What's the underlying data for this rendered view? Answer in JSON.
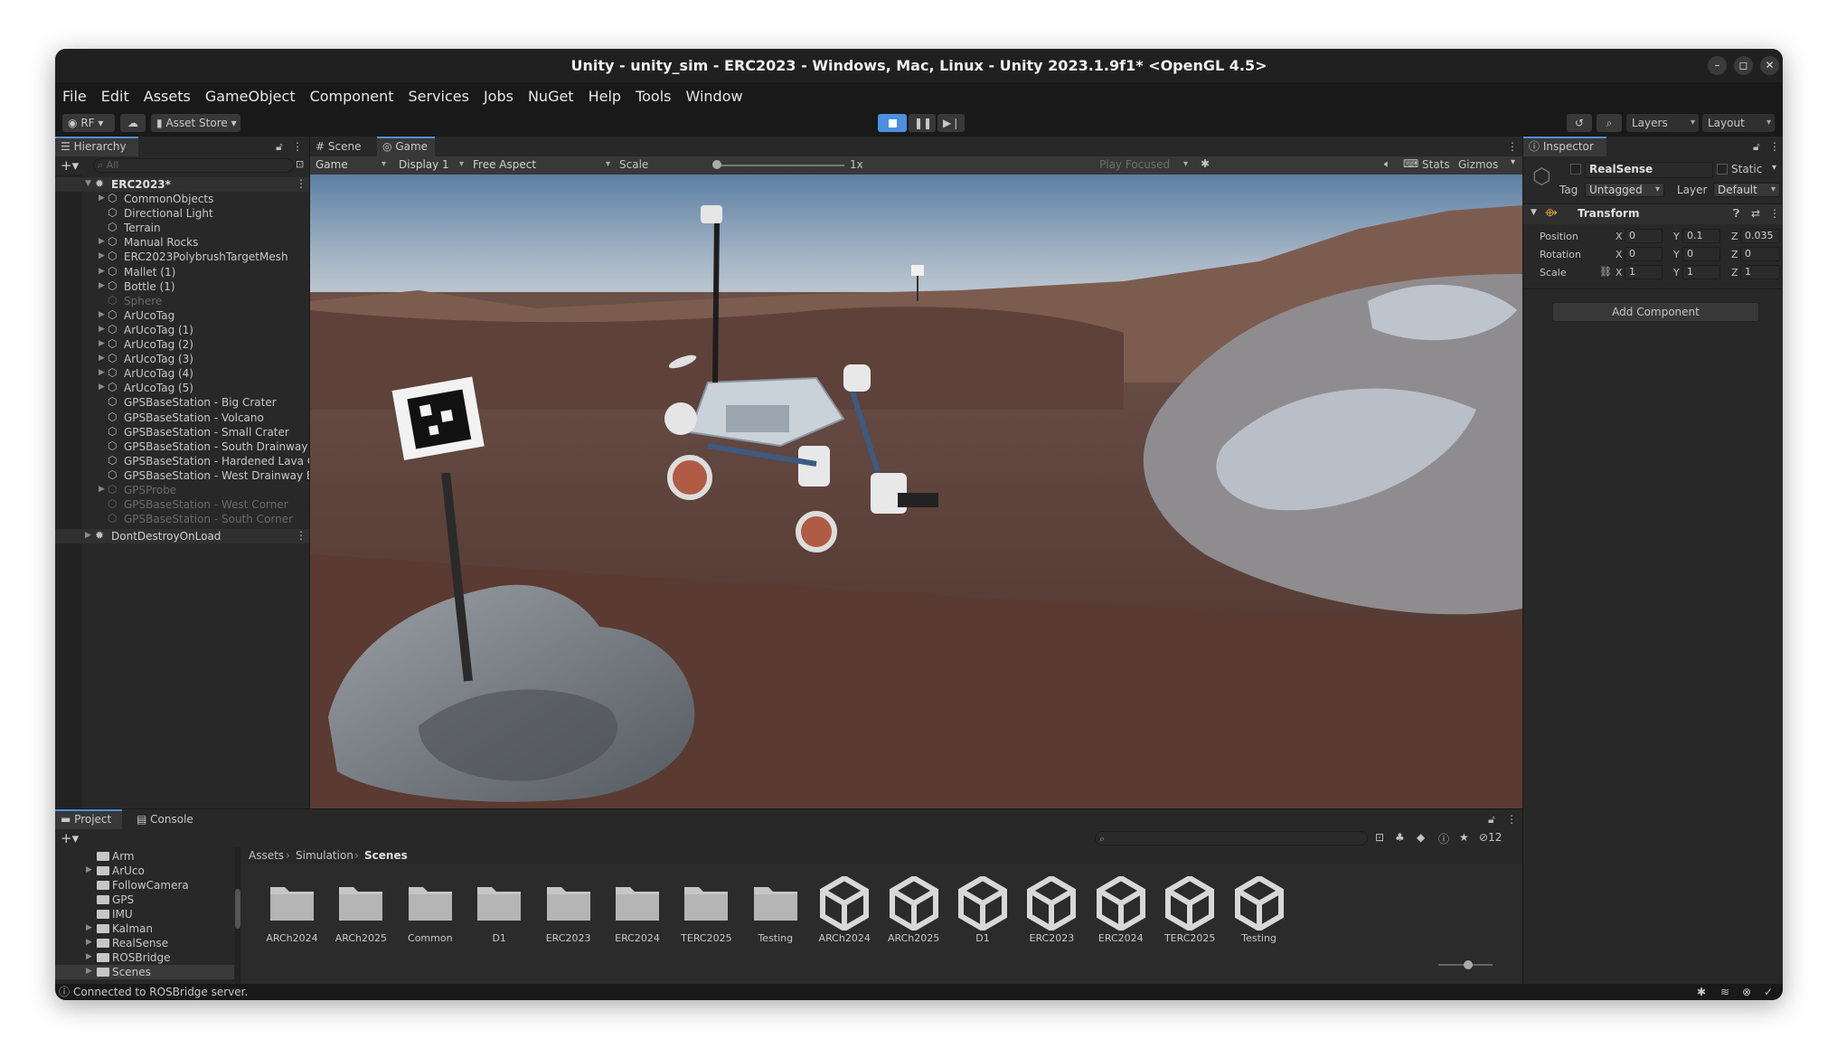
{
  "window": {
    "title": "Unity - unity_sim - ERC2023 - Windows, Mac, Linux - Unity 2023.1.9f1* <OpenGL 4.5>"
  },
  "menu": [
    "File",
    "Edit",
    "Assets",
    "GameObject",
    "Component",
    "Services",
    "Jobs",
    "NuGet",
    "Help",
    "Tools",
    "Window"
  ],
  "toolbar": {
    "account": "RF",
    "asset_store": "Asset Store",
    "layers": "Layers",
    "layout": "Layout"
  },
  "hierarchy": {
    "title": "Hierarchy",
    "search_placeholder": "All",
    "scene": "ERC2023*",
    "items": [
      {
        "label": "CommonObjects",
        "arrow": true,
        "dim": false
      },
      {
        "label": "Directional Light",
        "arrow": false,
        "dim": false
      },
      {
        "label": "Terrain",
        "arrow": false,
        "dim": false
      },
      {
        "label": "Manual Rocks",
        "arrow": true,
        "dim": false
      },
      {
        "label": "ERC2023PolybrushTargetMesh",
        "arrow": true,
        "dim": false
      },
      {
        "label": "Mallet (1)",
        "arrow": true,
        "dim": false
      },
      {
        "label": "Bottle (1)",
        "arrow": true,
        "dim": false
      },
      {
        "label": "Sphere",
        "arrow": false,
        "dim": true
      },
      {
        "label": "ArUcoTag",
        "arrow": true,
        "dim": false
      },
      {
        "label": "ArUcoTag (1)",
        "arrow": true,
        "dim": false
      },
      {
        "label": "ArUcoTag (2)",
        "arrow": true,
        "dim": false
      },
      {
        "label": "ArUcoTag (3)",
        "arrow": true,
        "dim": false
      },
      {
        "label": "ArUcoTag (4)",
        "arrow": true,
        "dim": false
      },
      {
        "label": "ArUcoTag (5)",
        "arrow": true,
        "dim": false
      },
      {
        "label": "GPSBaseStation - Big Crater",
        "arrow": false,
        "dim": false
      },
      {
        "label": "GPSBaseStation - Volcano",
        "arrow": false,
        "dim": false
      },
      {
        "label": "GPSBaseStation - Small Crater",
        "arrow": false,
        "dim": false
      },
      {
        "label": "GPSBaseStation - South Drainway B",
        "arrow": false,
        "dim": false
      },
      {
        "label": "GPSBaseStation - Hardened Lava C",
        "arrow": false,
        "dim": false
      },
      {
        "label": "GPSBaseStation - West Drainway B",
        "arrow": false,
        "dim": false
      },
      {
        "label": "GPSProbe",
        "arrow": true,
        "dim": true
      },
      {
        "label": "GPSBaseStation - West Corner",
        "arrow": false,
        "dim": true
      },
      {
        "label": "GPSBaseStation - South Corner",
        "arrow": false,
        "dim": true
      }
    ],
    "dont_destroy": "DontDestroyOnLoad"
  },
  "scene_tabs": {
    "scene": "Scene",
    "game": "Game"
  },
  "game_bar": {
    "view": "Game",
    "display": "Display 1",
    "aspect": "Free Aspect",
    "scale_label": "Scale",
    "scale_value": "1x",
    "play_focused": "Play Focused",
    "stats": "Stats",
    "gizmos": "Gizmos"
  },
  "inspector": {
    "title": "Inspector",
    "object_name": "RealSense",
    "static_label": "Static",
    "tag_label": "Tag",
    "tag_value": "Untagged",
    "layer_label": "Layer",
    "layer_value": "Default",
    "transform_title": "Transform",
    "position_label": "Position",
    "rotation_label": "Rotation",
    "scale_label": "Scale",
    "position": {
      "x": "0",
      "y": "0.1",
      "z": "0.035"
    },
    "rotation": {
      "x": "0",
      "y": "0",
      "z": "0"
    },
    "scale": {
      "x": "1",
      "y": "1",
      "z": "1"
    },
    "add_component": "Add Component"
  },
  "project": {
    "tab_project": "Project",
    "tab_console": "Console",
    "hidden_count": "12",
    "tree": [
      {
        "label": "Arm",
        "arrow": false
      },
      {
        "label": "ArUco",
        "arrow": true
      },
      {
        "label": "FollowCamera",
        "arrow": false
      },
      {
        "label": "GPS",
        "arrow": false
      },
      {
        "label": "IMU",
        "arrow": false
      },
      {
        "label": "Kalman",
        "arrow": true
      },
      {
        "label": "RealSense",
        "arrow": true
      },
      {
        "label": "ROSBridge",
        "arrow": true
      },
      {
        "label": "Scenes",
        "arrow": true
      }
    ],
    "breadcrumb": [
      "Assets",
      "Simulation",
      "Scenes"
    ],
    "folders": [
      "ARCh2024",
      "ARCh2025",
      "Common",
      "D1",
      "ERC2023",
      "ERC2024",
      "TERC2025",
      "Testing"
    ],
    "scenes": [
      "ARCh2024",
      "ARCh2025",
      "D1",
      "ERC2023",
      "ERC2024",
      "TERC2025",
      "Testing"
    ]
  },
  "status": {
    "message": "Connected to ROSBridge server."
  },
  "colors": {
    "accent": "#4d8fe0",
    "panel": "#282828",
    "bg": "#191919"
  }
}
